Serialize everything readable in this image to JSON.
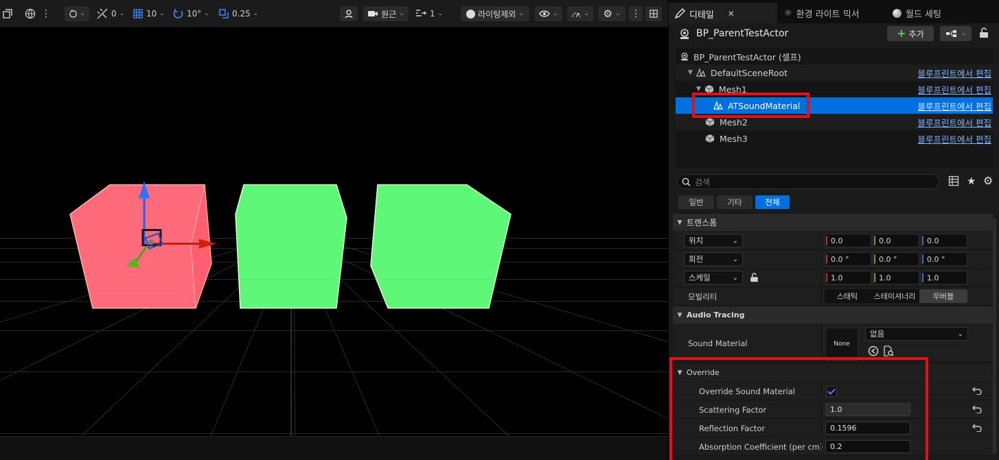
{
  "viewport": {
    "toolbar": {
      "snap_rotate_value": "0",
      "grid_value": "10",
      "rotation_value": "10°",
      "scale_value": "0.25",
      "camera_label": "원근",
      "speed_value": "1",
      "view_mode_label": "라이팅제외"
    },
    "objects": [
      {
        "name": "cube-1",
        "color": "#ff6b7a"
      },
      {
        "name": "cube-2",
        "color": "#5ff777"
      },
      {
        "name": "cube-3",
        "color": "#5ff777"
      }
    ]
  },
  "panel": {
    "tabs": [
      {
        "label": "디테일",
        "active": true
      },
      {
        "label": "환경 라이트 믹서",
        "active": false
      },
      {
        "label": "월드 세팅",
        "active": false
      }
    ],
    "actor_name": "BP_ParentTestActor",
    "add_label": "추가",
    "tree": [
      {
        "label": "BP_ParentTestActor (셀프)",
        "link": ""
      },
      {
        "label": "DefaultSceneRoot",
        "link": "블루프린트에서 편집"
      },
      {
        "label": "Mesh1",
        "link": "블루프린트에서 편집"
      },
      {
        "label": "ATSoundMaterial",
        "link": "블루프린트에서 편집",
        "selected": true
      },
      {
        "label": "Mesh2",
        "link": "블루프린트에서 편집"
      },
      {
        "label": "Mesh3",
        "link": "블루프린트에서 편집"
      }
    ],
    "search_placeholder": "검색",
    "filters": [
      "일반",
      "기타",
      "전체"
    ],
    "active_filter": "전체",
    "transform": {
      "section": "트랜스폼",
      "location_label": "위치",
      "rotation_label": "회전",
      "scale_label": "스케일",
      "location": [
        "0.0",
        "0.0",
        "0.0"
      ],
      "rotation": [
        "0.0 °",
        "0.0 °",
        "0.0 °"
      ],
      "scale": [
        "1.0",
        "1.0",
        "1.0"
      ],
      "mobility_label": "모빌리티",
      "mobility_options": [
        "스태틱",
        "스테이셔너리",
        "무버블"
      ],
      "mobility_selected": "무버블"
    },
    "audio_tracing": {
      "section": "Audio Tracing",
      "sound_material_label": "Sound Material",
      "thumbnail_label": "None",
      "asset_value": "없음"
    },
    "override": {
      "section": "Override",
      "rows": [
        {
          "label": "Override Sound Material",
          "type": "checkbox",
          "checked": true
        },
        {
          "label": "Scattering Factor",
          "type": "number",
          "value": "1.0"
        },
        {
          "label": "Reflection Factor",
          "type": "number",
          "value": "0.1596"
        },
        {
          "label": "Absorption Coefficient (per cm)",
          "type": "number",
          "value": "0.2"
        }
      ]
    }
  }
}
